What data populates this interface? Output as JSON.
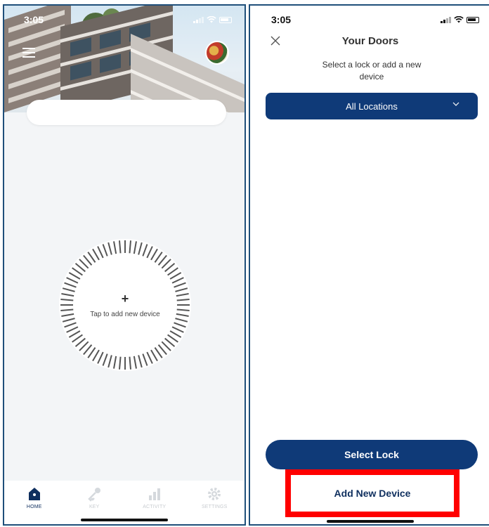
{
  "left_screen": {
    "status": {
      "time": "3:05"
    },
    "dial": {
      "plus": "+",
      "label": "Tap to add new device"
    },
    "tabs": [
      {
        "label": "HOME",
        "icon": "home-icon",
        "active": true
      },
      {
        "label": "KEY",
        "icon": "key-icon",
        "active": false
      },
      {
        "label": "ACTIVITY",
        "icon": "activity-icon",
        "active": false
      },
      {
        "label": "SETTINGS",
        "icon": "settings-icon",
        "active": false
      }
    ]
  },
  "right_screen": {
    "status": {
      "time": "3:05"
    },
    "title": "Your Doors",
    "subtitle": "Select a lock or add a new device",
    "location_select": {
      "value": "All Locations"
    },
    "select_lock_label": "Select Lock",
    "add_device_label": "Add New Device"
  },
  "colors": {
    "brand_navy": "#0f3a78",
    "highlight_red": "#ff0000",
    "frame_border": "#1f4f7a"
  }
}
